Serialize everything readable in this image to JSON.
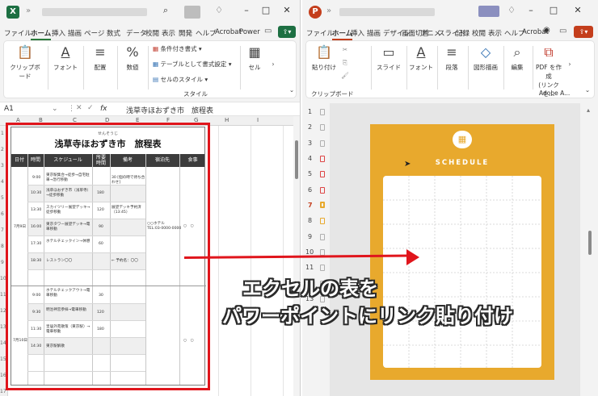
{
  "excel": {
    "app_letter": "X",
    "accent": "#1d6f42",
    "tabs": [
      "ファイル",
      "ホーム",
      "挿入",
      "描画",
      "ページ",
      "数式",
      "データ",
      "校閲",
      "表示",
      "開発",
      "ヘルプ",
      "Acrobat",
      "Power"
    ],
    "active_tab": "ホーム",
    "ribbon": {
      "clipboard": "クリップボード",
      "font": "フォント",
      "alignment": "配置",
      "number": "数値",
      "cond_format": "条件付き書式",
      "table_format": "テーブルとして書式設定",
      "cell_style": "セルのスタイル",
      "style_group": "スタイル",
      "cells": "セル"
    },
    "namebox": "A1",
    "fx": "fx",
    "formula": "浅草寺ほおずき市　旅程表",
    "columns": [
      "A",
      "B",
      "C",
      "D",
      "E",
      "F",
      "G",
      "H",
      "I"
    ],
    "rows": [
      "1",
      "2",
      "3",
      "4",
      "5",
      "6",
      "7",
      "8",
      "9",
      "10",
      "11",
      "12",
      "13",
      "14",
      "15",
      "16",
      "17"
    ]
  },
  "itinerary": {
    "ruby": "せんそうじ",
    "title": "浅草寺ほおずき市　旅程表",
    "headers": [
      "日付",
      "時間",
      "スケジュール",
      "所要\n時間",
      "備考",
      "宿泊先",
      "食事"
    ],
    "day1_date": "7月9日",
    "day2_date": "7月10日",
    "hotel": "○○ホテル\nTEL:03-0000-0000",
    "meal_mark": "○　○",
    "day1": [
      {
        "time": "9:00",
        "sched": "東京駅集合→徒歩→自宅駐車→急行移動",
        "dur": "",
        "note": "30 [個の時で待ち合わせ]"
      },
      {
        "time": "10:30",
        "sched": "浅草ほおずき市（浅草寺）→徒歩移動",
        "dur": "180",
        "note": ""
      },
      {
        "time": "13:30",
        "sched": "スカイツリー展望デッキ→徒歩移動",
        "dur": "120",
        "note": "展望デッキ予約済（13:45）"
      },
      {
        "time": "16:00",
        "sched": "東京タワー展望デッキ→電車移動",
        "dur": "90",
        "note": ""
      },
      {
        "time": "17:30",
        "sched": "ホテルチェックイン→休憩",
        "dur": "60",
        "note": ""
      },
      {
        "time": "18:30",
        "sched": "レストラン〇〇",
        "dur": "",
        "note": "← 予約名：〇〇"
      }
    ],
    "day2": [
      {
        "time": "9:00",
        "sched": "ホテルチェックアウト→電車移動",
        "dur": "30",
        "note": ""
      },
      {
        "time": "9:30",
        "sched": "明治神宮参拝→電車移動",
        "dur": "120",
        "note": ""
      },
      {
        "time": "11:30",
        "sched": "皇居外苑散策（東京駅）→電車移動",
        "dur": "180",
        "note": ""
      },
      {
        "time": "14:30",
        "sched": "東京駅解散",
        "dur": "",
        "note": ""
      }
    ]
  },
  "powerpoint": {
    "app_letter": "P",
    "accent": "#c43e1c",
    "tabs": [
      "ファイル",
      "ホーム",
      "挿入",
      "描画",
      "デザイン",
      "画面切替",
      "アニメ",
      "スライド",
      "記録",
      "校閲",
      "表示",
      "ヘルプ",
      "Acrobat"
    ],
    "active_tab": "ホーム",
    "ribbon": {
      "paste": "貼り付け",
      "clipboard": "クリップボード",
      "slide": "スライド",
      "font": "フォント",
      "paragraph": "段落",
      "shapes": "図形描画",
      "edit": "編集",
      "pdf": "PDF を作成",
      "pdf_sub": "(リンクを...",
      "adobe": "Adobe A..."
    },
    "slide_numbers": [
      "1",
      "2",
      "3",
      "4",
      "5",
      "6",
      "7",
      "8",
      "9",
      "10",
      "11",
      "12",
      "13"
    ],
    "active_slide": "7",
    "slide_title": "SCHEDULE",
    "slide_color": "#e8a92d"
  },
  "caption": {
    "line1": "エクセルの表を",
    "line2": "パワーポイントにリンク貼り付け",
    "color": "#e0151c"
  }
}
